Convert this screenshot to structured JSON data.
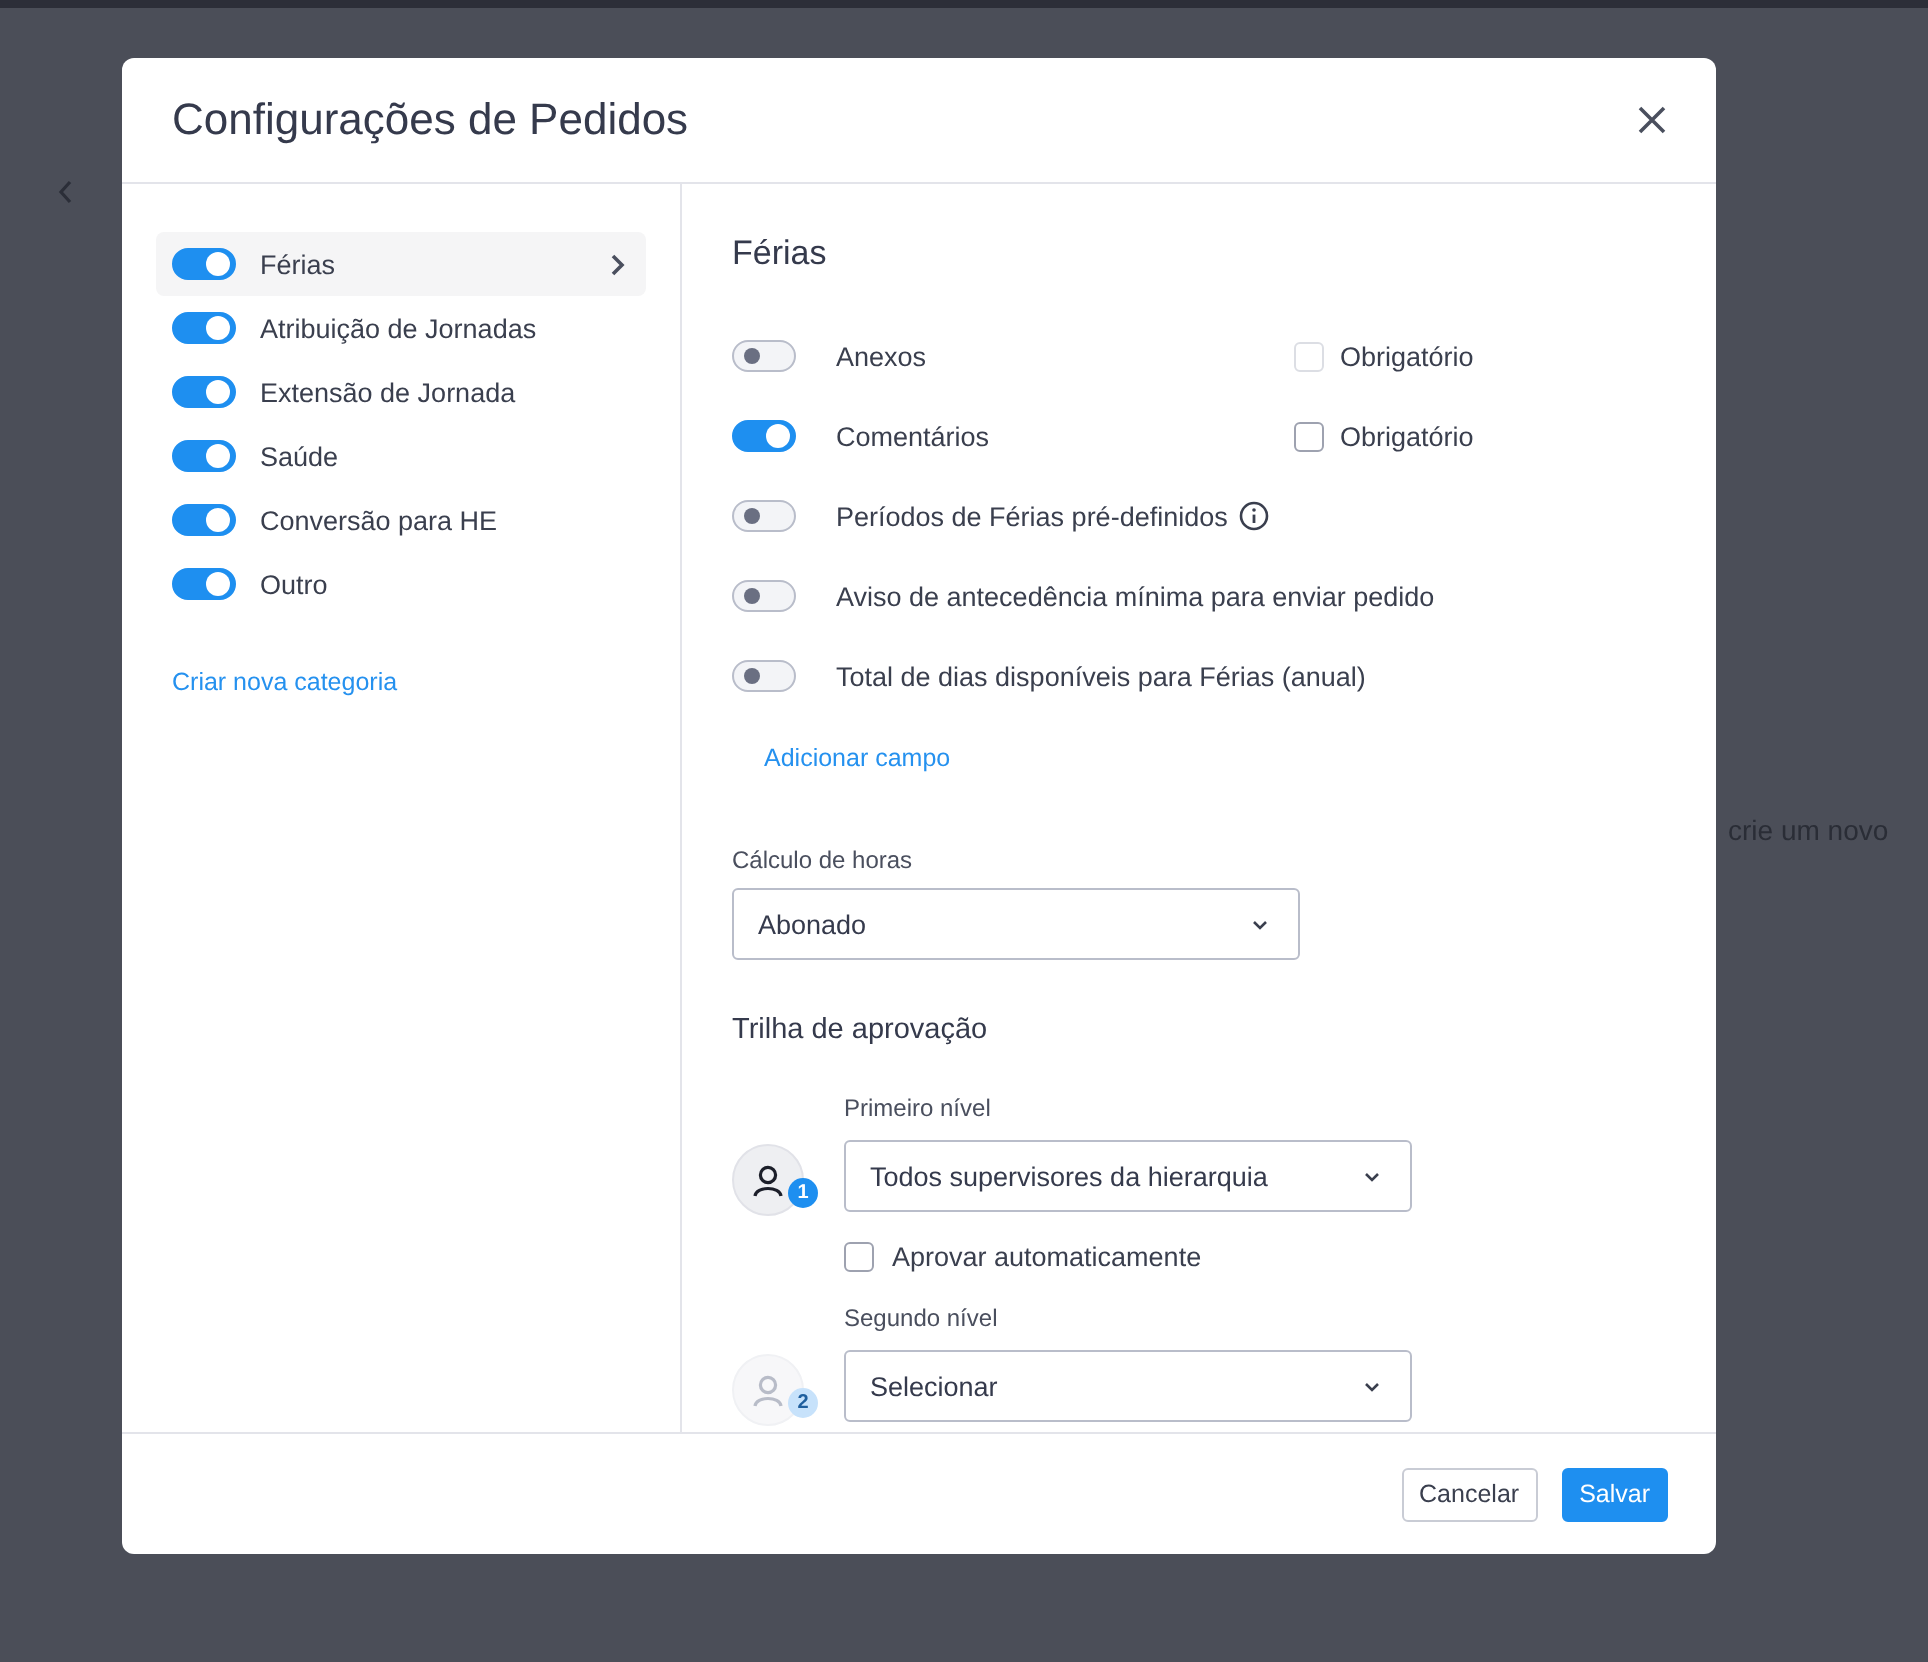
{
  "background": {
    "partial_text": "crie um novo"
  },
  "dialog": {
    "title": "Configurações de Pedidos",
    "categories": [
      {
        "label": "Férias",
        "on": true,
        "selected": true
      },
      {
        "label": "Atribuição de Jornadas",
        "on": true,
        "selected": false
      },
      {
        "label": "Extensão de Jornada",
        "on": true,
        "selected": false
      },
      {
        "label": "Saúde",
        "on": true,
        "selected": false
      },
      {
        "label": "Conversão para HE",
        "on": true,
        "selected": false
      },
      {
        "label": "Outro",
        "on": true,
        "selected": false
      }
    ],
    "new_category_link": "Criar nova categoria",
    "section_title": "Férias",
    "fields": [
      {
        "label": "Anexos",
        "on": false,
        "required": {
          "label": "Obrigatório",
          "checked": false,
          "disabled": true
        }
      },
      {
        "label": "Comentários",
        "on": true,
        "required": {
          "label": "Obrigatório",
          "checked": false,
          "disabled": false
        }
      },
      {
        "label": "Períodos de Férias pré-definidos",
        "on": false,
        "info": true
      },
      {
        "label": "Aviso de antecedência mínima para enviar pedido",
        "on": false
      },
      {
        "label": "Total de dias disponíveis para Férias (anual)",
        "on": false
      }
    ],
    "add_field_link": "Adicionar campo",
    "hours": {
      "label": "Cálculo de horas",
      "value": "Abonado"
    },
    "approval": {
      "title": "Trilha de aprovação",
      "levels": [
        {
          "label": "Primeiro nível",
          "badge": "1",
          "value": "Todos supervisores da hierarquia",
          "active": true,
          "auto_approve": {
            "label": "Aprovar automaticamente",
            "checked": false
          }
        },
        {
          "label": "Segundo nível",
          "badge": "2",
          "value": "Selecionar",
          "active": false
        }
      ]
    },
    "buttons": [
      {
        "label": "Cancelar",
        "kind": "secondary"
      },
      {
        "label": "Salvar",
        "kind": "primary"
      }
    ]
  }
}
